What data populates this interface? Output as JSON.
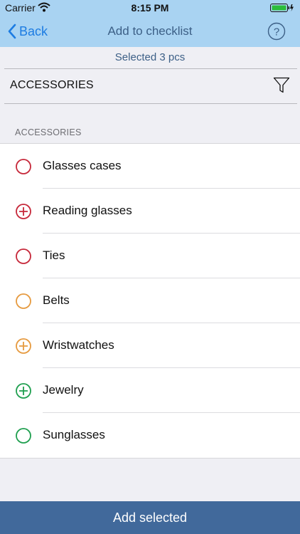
{
  "status_bar": {
    "carrier": "Carrier",
    "time": "8:15 PM"
  },
  "nav": {
    "back_label": "Back",
    "title": "Add to checklist",
    "help_glyph": "?",
    "accent_color": "#1d7ce2"
  },
  "selection_text": "Selected 3 pcs",
  "filter": {
    "value": "ACCESSORIES",
    "icon": "funnel-icon"
  },
  "section": {
    "header": "ACCESSORIES",
    "items": [
      {
        "label": "Glasses cases",
        "color": "#c6283a",
        "selected": false
      },
      {
        "label": "Reading glasses",
        "color": "#c6283a",
        "selected": true
      },
      {
        "label": "Ties",
        "color": "#c6283a",
        "selected": false
      },
      {
        "label": "Belts",
        "color": "#e69a3f",
        "selected": false
      },
      {
        "label": "Wristwatches",
        "color": "#e69a3f",
        "selected": true
      },
      {
        "label": "Jewelry",
        "color": "#1f9f4f",
        "selected": true
      },
      {
        "label": "Sunglasses",
        "color": "#1f9f4f",
        "selected": false
      }
    ]
  },
  "footer": {
    "button_label": "Add selected",
    "color": "#41699b"
  }
}
